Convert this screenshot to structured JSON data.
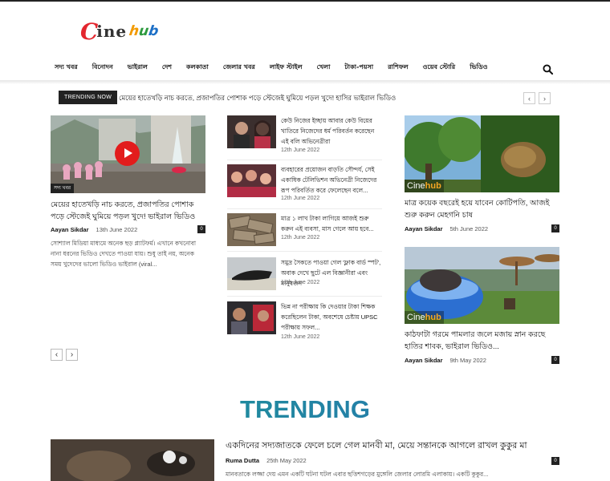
{
  "site": {
    "logo_c": "C",
    "logo_ine": "ine",
    "logo_hub": [
      "h",
      "u",
      "b"
    ]
  },
  "nav": [
    "সদ্য খবর",
    "বিনোদন",
    "ভাইরাল",
    "দেশ",
    "কলকাতা",
    "জেলার খবর",
    "লাইফ স্টাইল",
    "খেলা",
    "টাকা-পয়সা",
    "রাশিফল",
    "ওয়েব স্টোরি",
    "ভিডিও"
  ],
  "ticker": {
    "badge": "TRENDING NOW",
    "text": "মেয়ের হাতেখড়ি নাচ করতে, প্রজাপতির পোশাক পড়ে স্টেজেই ঘুমিয়ে পড়ল খুদে! হাসির ভাইরাল ভিডিও",
    "prev": "‹",
    "next": "›"
  },
  "col1": {
    "category": "সদ্য খবর",
    "title": "মেয়ের হাতেখড়ি নাচ করতে, প্রজাপতির পোশাক পড়ে স্টেজেই ঘুমিয়ে পড়ল খুদে! ভাইরাল ভিডিও",
    "author": "Aayan Sikdar",
    "date": "13th June 2022",
    "comments": "0",
    "excerpt": "সোশ্যাল মিডিয়া মাধ্যমে অনেক ছড় প্ল্যাটফর্ম। এখানে কখনোবা নানা ধরনের ভিডিও দেখতে পাওয়া যায়। শুধু তাই নয়, অনেক সময় খুদেদের ভালো ভিডিও ভাইরাল (viral...",
    "pager_prev": "‹",
    "pager_next": "›"
  },
  "col2": [
    {
      "title": "কেউ নিজের ইচ্ছায় আবার কেউ বিয়ের খাতিরে নিজেদের ধর্ম পরিবর্তন করেছেন এই বলি অভিনেত্রীরা",
      "date": "12th June 2022"
    },
    {
      "title": "ব্যবহারের প্রয়োজন বাড়তি সৌন্দর্য, সেই একাধিক টেলিভিশন অভিনেত্রী নিজেদের রূপ পরিবর্তিত করে ফেলেছেন বলে...",
      "date": "12th June 2022"
    },
    {
      "title": "মাত্র ১ লাখ টাকা লাগিয়ে আজই শুরু করুন এই ব্যবসা, মাস গেলে আয় হবে...",
      "date": "12th June 2022"
    },
    {
      "title": "সমুদ্র সৈকতে পাওয়া গেল 'ফ্লাক বার্ড স্পট', অবাক দেখে ছুটে এল বিজ্ঞানীরা এবং মানুষজন",
      "date": "12th June 2022"
    },
    {
      "title": "ভিন্ন না পরীক্ষায় কি দেওয়ার টাকা শিক্ষক করেছিলেন টাকা, অবশেষে চেষ্টায় UPSC পরীক্ষায় সফল...",
      "date": "12th June 2022"
    }
  ],
  "col3": [
    {
      "title": "মাত্র কয়েক বছরেই হয়ে যাবেন কোটিপতি, আজই শুরু করুন মেহগনি চাষ",
      "author": "Aayan Sikdar",
      "date": "5th June 2022",
      "comments": "0",
      "logo_a": "Cine",
      "logo_b": "hub"
    },
    {
      "title": "কাঠফাটা গরমে পামলার জলে মজায় স্নান করছে হাতির শাবক, ভাইরাল ভিডিও...",
      "author": "Aayan Sikdar",
      "date": "9th May 2022",
      "comments": "0",
      "logo_a": "Cine",
      "logo_b": "hub"
    }
  ],
  "trending": {
    "heading": "TRENDING",
    "title": "একদিনের সদ্যজাতকে ফেলে চলে গেল মানবী মা, মেয়ে সন্তানকে আগলে রাখল কুকুর মা",
    "author": "Ruma Dutta",
    "date": "25th May 2022",
    "comments": "0",
    "excerpt": "মানবতাকে লজ্জা দেয় এমন একটি ঘটনা ঘটল এবার ছত্তিশগড়ের মুঙ্গেলি জেলার লোরমি এলাকায়। একটি কুকুর..."
  }
}
